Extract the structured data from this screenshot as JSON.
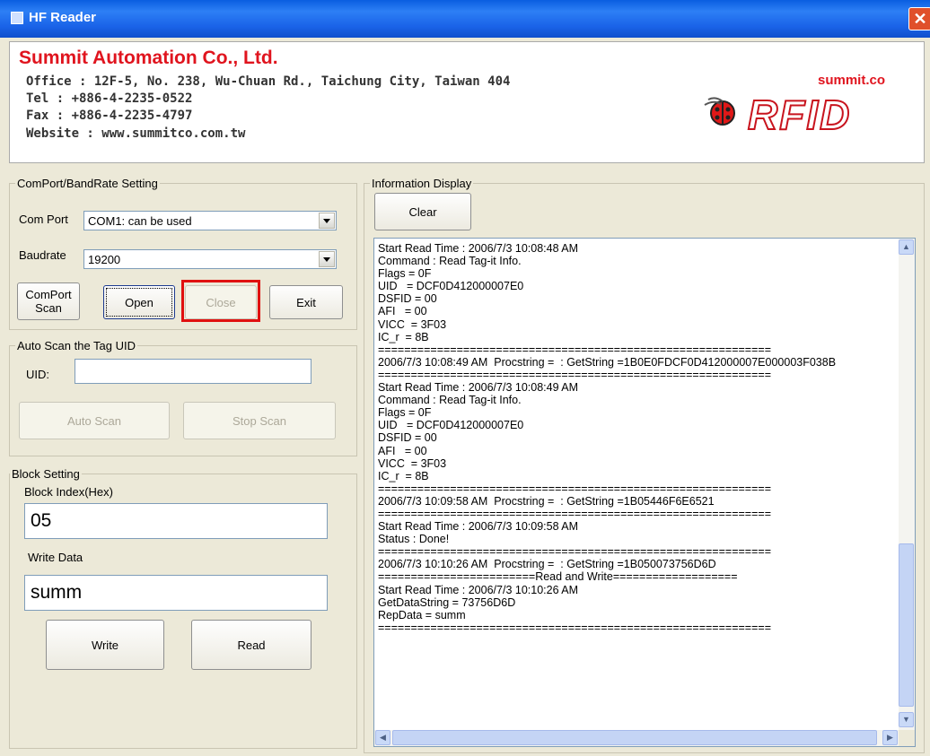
{
  "window": {
    "title": "HF Reader",
    "close_glyph": "✕"
  },
  "header": {
    "company": "Summit Automation Co., Ltd.",
    "office": "Office : 12F-5, No. 238, Wu-Chuan Rd., Taichung City, Taiwan 404",
    "tel": "Tel : +886-4-2235-0522",
    "fax": "Fax : +886-4-2235-4797",
    "website": "Website : www.summitco.com.tw",
    "logo_domain": "summit.co",
    "logo_text": "RFID"
  },
  "comport": {
    "legend": "ComPort/BandRate Setting",
    "com_port_label": "Com Port",
    "com_port_value": "COM1: can be used",
    "baudrate_label": "Baudrate",
    "baudrate_value": "19200",
    "scan_button": "ComPort Scan",
    "open_button": "Open",
    "close_button": "Close",
    "exit_button": "Exit"
  },
  "autoscan": {
    "legend": "Auto Scan the Tag UID",
    "uid_label": "UID:",
    "uid_value": "",
    "auto_scan_button": "Auto Scan",
    "stop_scan_button": "Stop Scan"
  },
  "block": {
    "legend": "Block Setting",
    "index_label": "Block Index(Hex)",
    "index_value": "05",
    "write_label": "Write Data",
    "write_value": "summ",
    "write_button": "Write",
    "read_button": "Read"
  },
  "info": {
    "legend": "Information Display",
    "clear_button": "Clear",
    "log": "Start Read Time : 2006/7/3 10:08:48 AM\nCommand : Read Tag-it Info.\nFlags = 0F\nUID   = DCF0D412000007E0\nDSFID = 00\nAFI   = 00\nVICC  = 3F03\nIC_r  = 8B\n============================================================\n2006/7/3 10:08:49 AM  Procstring =  : GetString =1B0E0FDCF0D412000007E000003F038B\n============================================================\nStart Read Time : 2006/7/3 10:08:49 AM\nCommand : Read Tag-it Info.\nFlags = 0F\nUID   = DCF0D412000007E0\nDSFID = 00\nAFI   = 00\nVICC  = 3F03\nIC_r  = 8B\n============================================================\n2006/7/3 10:09:58 AM  Procstring =  : GetString =1B05446F6E6521\n============================================================\nStart Read Time : 2006/7/3 10:09:58 AM\nStatus : Done!\n============================================================\n2006/7/3 10:10:26 AM  Procstring =  : GetString =1B050073756D6D\n========================Read and Write===================\nStart Read Time : 2006/7/3 10:10:26 AM\nGetDataString = 73756D6D\nRepData = summ\n============================================================",
    "scroll_up": "▲",
    "scroll_down": "▼",
    "scroll_left": "◀",
    "scroll_right": "▶"
  }
}
